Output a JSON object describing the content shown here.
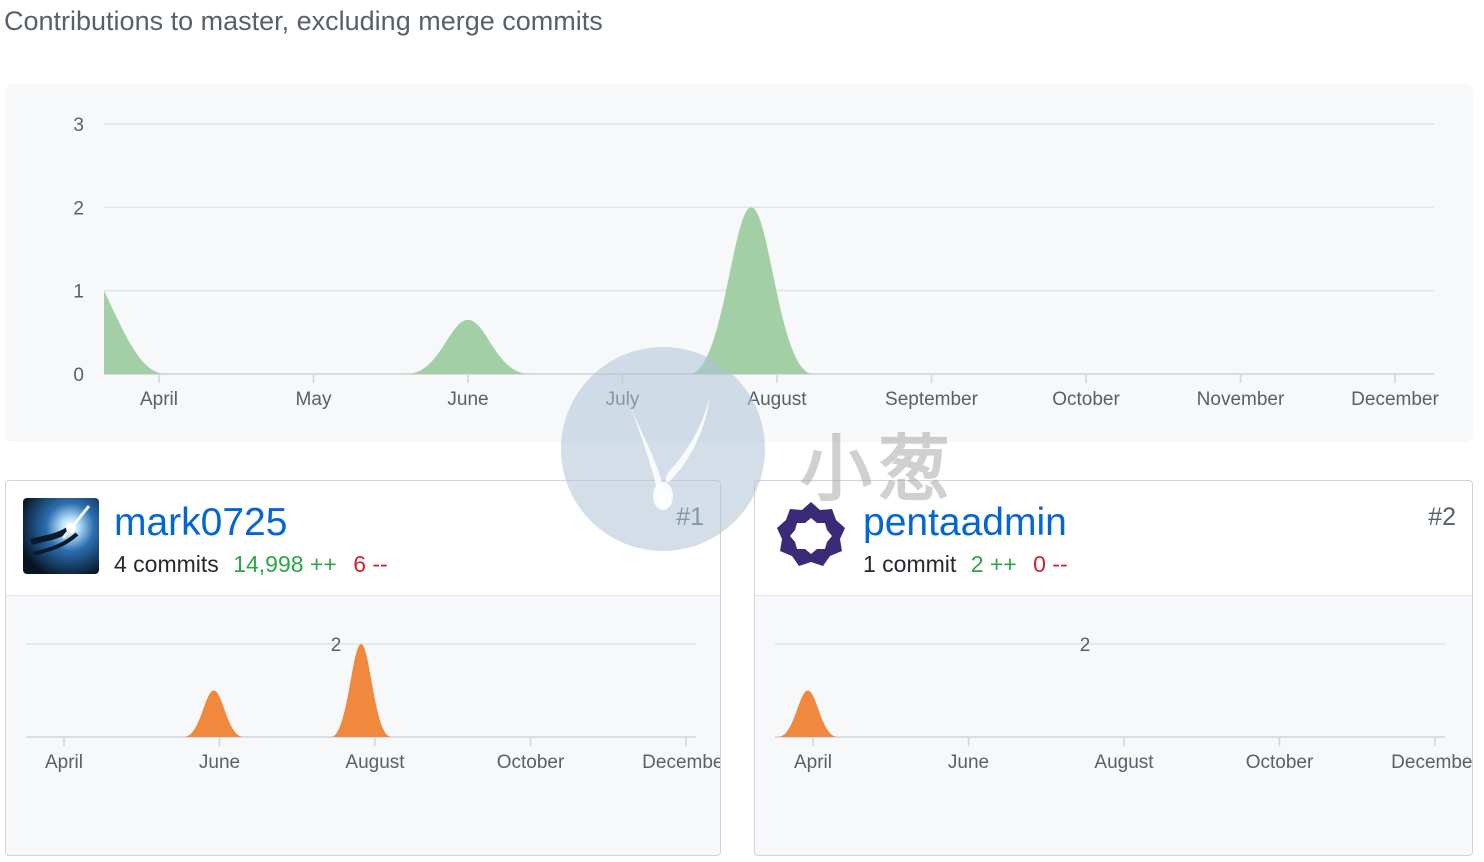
{
  "page": {
    "heading": "Contributions to master, excluding merge commits"
  },
  "colors": {
    "main_series": "#a2cfa5",
    "contributor_series": "#f0883e",
    "link": "#0366d6",
    "additions": "#28a745",
    "deletions": "#cb2431"
  },
  "chart_data": [
    {
      "type": "area",
      "title": "",
      "xlabel": "",
      "ylabel": "",
      "ylim": [
        0,
        3
      ],
      "y_ticks": [
        "0",
        "1",
        "2",
        "3"
      ],
      "x_ticks": [
        "April",
        "May",
        "June",
        "July",
        "August",
        "September",
        "October",
        "November",
        "December"
      ],
      "grid": true,
      "series": [
        {
          "points": [
            {
              "x": "March 29",
              "y": 1
            },
            {
              "x": "May 31",
              "y": 0.65
            },
            {
              "x": "July 26",
              "y": 2
            }
          ]
        }
      ]
    },
    {
      "type": "area",
      "y_ticks": [
        "2"
      ],
      "x_ticks": [
        "April",
        "June",
        "August",
        "October",
        "December"
      ],
      "grid": true,
      "series": [
        {
          "points": [
            {
              "x": "May 29",
              "y": 1
            },
            {
              "x": "July 26",
              "y": 2
            }
          ]
        }
      ]
    },
    {
      "type": "area",
      "y_ticks": [
        "2"
      ],
      "x_ticks": [
        "April",
        "June",
        "August",
        "October",
        "December"
      ],
      "grid": true,
      "series": [
        {
          "points": [
            {
              "x": "March 29",
              "y": 1
            }
          ]
        }
      ]
    }
  ],
  "contributors": [
    {
      "username": "mark0725",
      "commits": "4 commits",
      "additions": "14,998 ++",
      "deletions": "6 --",
      "rank": "#1",
      "avatar_icon": "comet-avatar-icon"
    },
    {
      "username": "pentaadmin",
      "commits": "1 commit",
      "additions": "2 ++",
      "deletions": "0 --",
      "rank": "#2",
      "avatar_icon": "ring-avatar-icon"
    }
  ],
  "watermark": {
    "text": "小葱"
  }
}
